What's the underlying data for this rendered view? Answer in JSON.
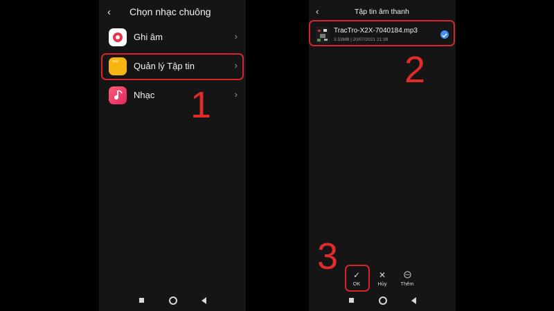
{
  "left_screen": {
    "title": "Chọn nhạc chuông",
    "items": [
      {
        "label": "Ghi âm",
        "icon": "recorder-icon"
      },
      {
        "label": "Quản lý Tập tin",
        "icon": "folder-icon"
      },
      {
        "label": "Nhạc",
        "icon": "music-icon"
      }
    ],
    "step": "1"
  },
  "right_screen": {
    "title": "Tập tin âm thanh",
    "file": {
      "name": "TracTro-X2X-7040184.mp3",
      "meta": "3.53MB | 20/07/2021 21:39",
      "selected": true
    },
    "actions": [
      {
        "label": "OK",
        "icon": "check-icon"
      },
      {
        "label": "Hủy",
        "icon": "close-icon"
      },
      {
        "label": "Thêm",
        "icon": "more-icon"
      }
    ],
    "step_file": "2",
    "step_ok": "3"
  },
  "colors": {
    "highlight": "#d8242a",
    "step_number": "#e32b2b",
    "recorder": "#e8344a",
    "folder": "#f7b514",
    "music": "#ee3b6b",
    "check": "#3d8ff3",
    "screen_bg": "#151515"
  }
}
